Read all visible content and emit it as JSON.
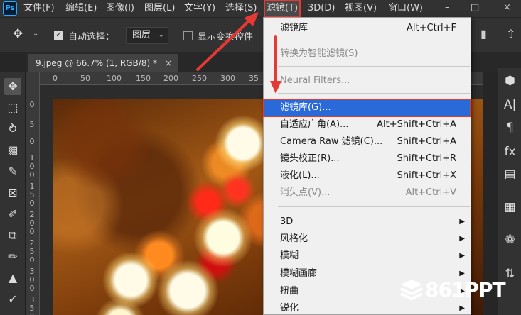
{
  "app": {
    "logo": "Ps"
  },
  "menubar": {
    "items": [
      "文件(F)",
      "编辑(E)",
      "图像(I)",
      "图层(L)",
      "文字(Y)",
      "选择(S)",
      "滤镜(T)",
      "3D(D)",
      "视图(V)",
      "窗口(W)"
    ],
    "active": "滤镜(T)"
  },
  "options": {
    "auto_select_label": "自动选择：",
    "auto_select_value": "图层",
    "show_transform_label": "显示变换控件"
  },
  "document": {
    "tab_title": "9.jpeg @ 66.7% (1, RGB/8) *",
    "close_glyph": "×"
  },
  "ruler": {
    "h_ticks": [
      "0",
      "50",
      "100",
      "150",
      "200",
      "250",
      "300",
      "35"
    ],
    "v_ticks": [
      "0",
      "5",
      "0",
      "1 0 0",
      "1 5 0",
      "2 0 0",
      "2 5 0",
      "3 0 0",
      "3 5 0"
    ]
  },
  "filter_menu": {
    "items": [
      {
        "label": "滤镜库",
        "shortcut": "Alt+Ctrl+F",
        "disabled": false
      },
      {
        "label": "转换为智能滤镜(S)",
        "shortcut": "",
        "disabled": true
      },
      {
        "label": "Neural Filters...",
        "shortcut": "",
        "disabled": true
      },
      {
        "label": "滤镜库(G)...",
        "shortcut": "",
        "disabled": false,
        "highlighted": true
      },
      {
        "label": "自适应广角(A)...",
        "shortcut": "Alt+Shift+Ctrl+A",
        "disabled": false
      },
      {
        "label": "Camera Raw 滤镜(C)...",
        "shortcut": "Shift+Ctrl+A",
        "disabled": false
      },
      {
        "label": "镜头校正(R)...",
        "shortcut": "Shift+Ctrl+R",
        "disabled": false
      },
      {
        "label": "液化(L)...",
        "shortcut": "Shift+Ctrl+X",
        "disabled": false
      },
      {
        "label": "消失点(V)...",
        "shortcut": "Alt+Ctrl+V",
        "disabled": true
      },
      {
        "label": "3D",
        "submenu": true
      },
      {
        "label": "风格化",
        "submenu": true
      },
      {
        "label": "模糊",
        "submenu": true
      },
      {
        "label": "模糊画廊",
        "submenu": true
      },
      {
        "label": "扭曲",
        "submenu": true
      },
      {
        "label": "锐化",
        "submenu": true
      }
    ]
  },
  "watermark": {
    "text": "861PPT"
  },
  "colors": {
    "highlight": "#2a6ad8",
    "annotation": "#e53935"
  }
}
